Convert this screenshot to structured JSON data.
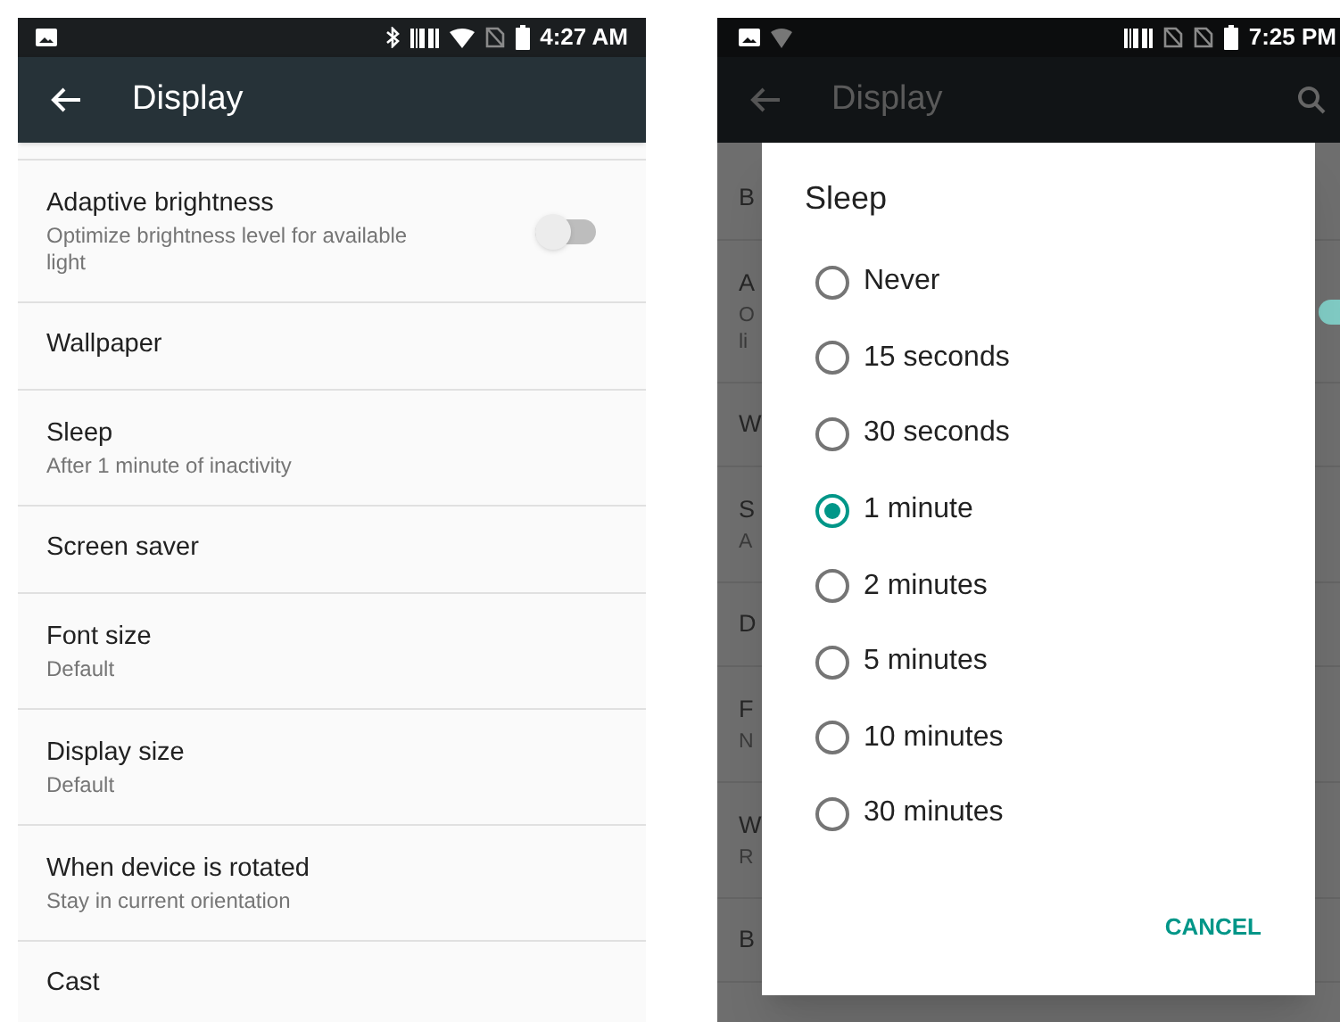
{
  "left_screen": {
    "status_bar": {
      "time": "4:27 AM"
    },
    "app_bar": {
      "title": "Display"
    },
    "settings": [
      {
        "kind": "switch",
        "title": "Adaptive brightness",
        "subtitle": "Optimize brightness level for available light",
        "on": false
      },
      {
        "kind": "plain",
        "title": "Wallpaper"
      },
      {
        "kind": "plain",
        "title": "Sleep",
        "subtitle": "After 1 minute of inactivity"
      },
      {
        "kind": "plain",
        "title": "Screen saver"
      },
      {
        "kind": "plain",
        "title": "Font size",
        "subtitle": "Default"
      },
      {
        "kind": "plain",
        "title": "Display size",
        "subtitle": "Default"
      },
      {
        "kind": "plain",
        "title": "When device is rotated",
        "subtitle": "Stay in current orientation"
      },
      {
        "kind": "plain",
        "title": "Cast"
      }
    ]
  },
  "right_screen": {
    "status_bar": {
      "time": "7:25 PM"
    },
    "app_bar": {
      "title": "Display"
    },
    "background_rows": [
      {
        "kind": "plain",
        "lines": [
          "B"
        ]
      },
      {
        "kind": "switch",
        "lines": [
          "A",
          "O",
          "li"
        ],
        "on": true
      },
      {
        "kind": "plain",
        "lines": [
          "W"
        ]
      },
      {
        "kind": "plain",
        "lines": [
          "S",
          "A"
        ]
      },
      {
        "kind": "plain",
        "lines": [
          "D"
        ]
      },
      {
        "kind": "plain",
        "lines": [
          "F",
          "N"
        ]
      },
      {
        "kind": "plain",
        "lines": [
          "W",
          "R"
        ]
      },
      {
        "kind": "plain",
        "lines": [
          "B"
        ]
      }
    ],
    "dialog": {
      "title": "Sleep",
      "options": [
        {
          "label": "Never",
          "selected": false
        },
        {
          "label": "15 seconds",
          "selected": false
        },
        {
          "label": "30 seconds",
          "selected": false
        },
        {
          "label": "1 minute",
          "selected": true
        },
        {
          "label": "2 minutes",
          "selected": false
        },
        {
          "label": "5 minutes",
          "selected": false
        },
        {
          "label": "10 minutes",
          "selected": false
        },
        {
          "label": "30 minutes",
          "selected": false
        }
      ],
      "button": "CANCEL"
    }
  }
}
